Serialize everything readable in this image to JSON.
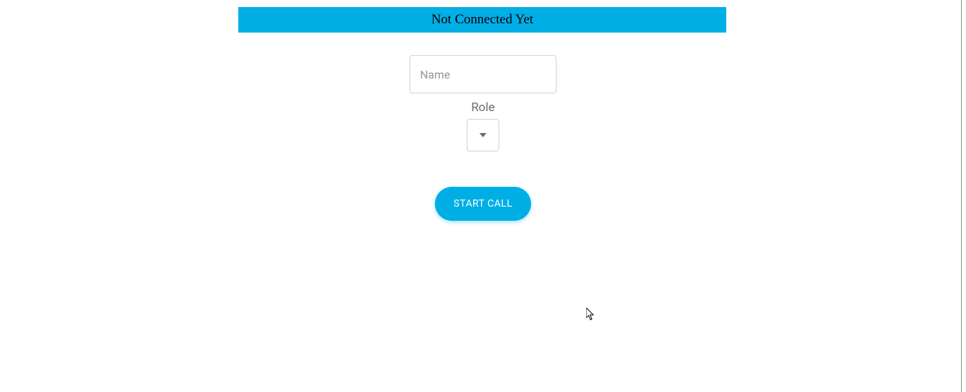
{
  "status": {
    "message": "Not Connected Yet"
  },
  "form": {
    "name_placeholder": "Name",
    "name_value": "",
    "role_label": "Role",
    "role_selected": ""
  },
  "actions": {
    "start_call_label": "START CALL"
  }
}
